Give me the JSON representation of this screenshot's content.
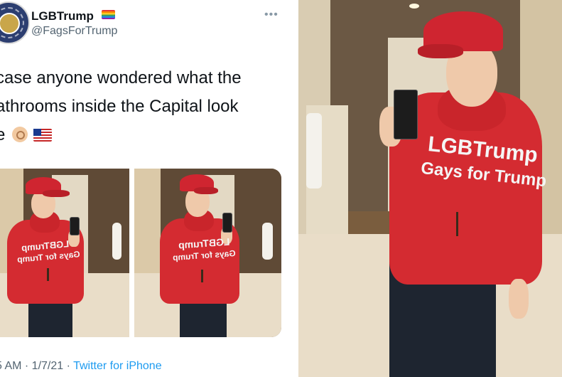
{
  "tweet": {
    "display_name": "LGBTrump",
    "handle": "@FagsForTrump",
    "more_label": "•••",
    "text_lines": [
      "case anyone wondered what the",
      "athrooms inside the Capital look",
      "e"
    ],
    "timestamp": "5 AM · 1/7/21 · ",
    "source": "Twitter for iPhone"
  },
  "shirt_print": {
    "line1": "LGBTrump",
    "line2": "Gays for Trump"
  },
  "icons": [
    "rainbow-flag-icon",
    "more-icon",
    "ok-hand-icon",
    "us-flag-icon"
  ],
  "colors": {
    "link": "#1d9bf0",
    "secondary_text": "#536471",
    "hoodie_red": "#d42b31"
  }
}
